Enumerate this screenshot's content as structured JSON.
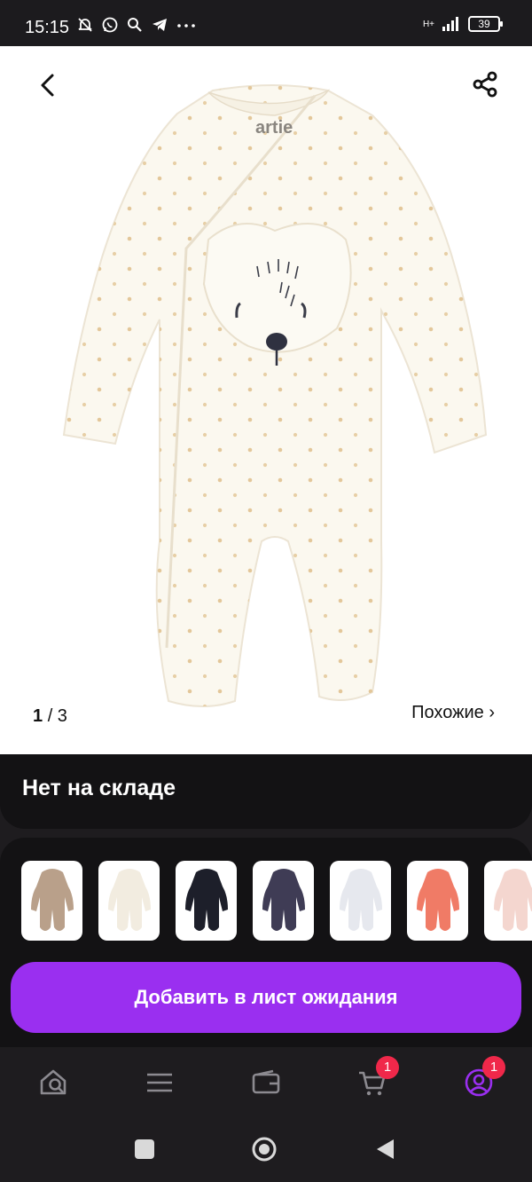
{
  "status_bar": {
    "time": "15:15",
    "network": "H+",
    "battery": "39"
  },
  "product": {
    "brand_mark": "artie",
    "pager_current": "1",
    "pager_total": "/ 3",
    "similar_link": "Похожие ›",
    "stock_status": "Нет на складе",
    "wait_button": "Добавить в лист ожидания"
  },
  "thumbnails": [
    {
      "name": "camo-hooded-jumpsuit",
      "color": "#b9a08a"
    },
    {
      "name": "cream-dotted-sleepsuit",
      "color": "#f2ece0"
    },
    {
      "name": "dino-print-jumpsuit",
      "color": "#1d1f2a"
    },
    {
      "name": "navy-sleepsuit",
      "color": "#3f3c55"
    },
    {
      "name": "white-print-sleepsuit",
      "color": "#e6e8ee"
    },
    {
      "name": "coral-sleepsuit",
      "color": "#f07b66"
    },
    {
      "name": "pink-dotted-sleepsuit",
      "color": "#f4d6cf"
    }
  ],
  "navbar": {
    "items": [
      "home-search",
      "catalog",
      "wallet",
      "cart",
      "profile"
    ],
    "cart_badge": "1",
    "profile_badge": "1",
    "accent": "#9a2ff0"
  }
}
